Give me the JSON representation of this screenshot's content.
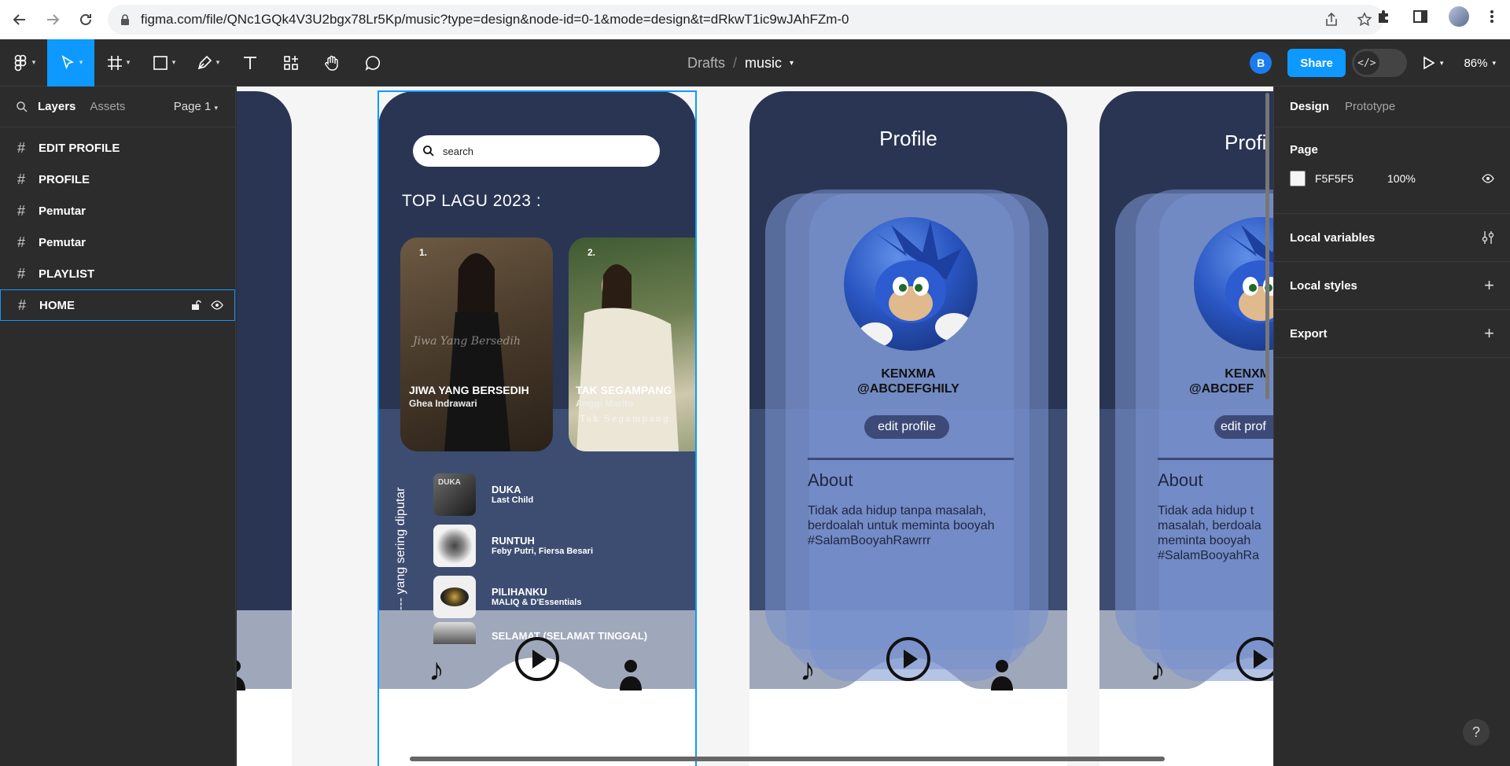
{
  "browser": {
    "url": "figma.com/file/QNc1GQk4V3U2bgx78Lr5Kp/music?type=design&node-id=0-1&mode=design&t=dRkwT1ic9wJAhFZm-0"
  },
  "toolbar": {
    "tools": [
      "figma-menu-icon",
      "move-tool-icon",
      "frame-tool-icon",
      "shape-tool-icon",
      "pen-tool-icon",
      "text-tool-icon",
      "resources-icon",
      "hand-tool-icon",
      "comment-tool-icon"
    ],
    "breadcrumb_parent": "Drafts",
    "breadcrumb_sep": "/",
    "file_name": "music",
    "user_initial": "B",
    "share_label": "Share",
    "dev_mode_glyph": "</>",
    "zoom": "86%"
  },
  "left_panel": {
    "tab_layers": "Layers",
    "tab_assets": "Assets",
    "page_selector": "Page 1",
    "layers": [
      {
        "name": "EDIT PROFILE",
        "selected": false
      },
      {
        "name": "PROFILE",
        "selected": false
      },
      {
        "name": "Pemutar",
        "selected": false
      },
      {
        "name": "Pemutar",
        "selected": false
      },
      {
        "name": "PLAYLIST",
        "selected": false
      },
      {
        "name": "HOME",
        "selected": true
      }
    ]
  },
  "right_panel": {
    "tab_design": "Design",
    "tab_prototype": "Prototype",
    "page_title": "Page",
    "page_color": "F5F5F5",
    "page_opacity": "100%",
    "local_variables": "Local variables",
    "local_styles": "Local styles",
    "export": "Export",
    "help": "?"
  },
  "home_frame": {
    "search_placeholder": "search",
    "top_heading": "TOP LAGU 2023 :",
    "top_songs": [
      {
        "rank": "1.",
        "title": "JIWA YANG BERSEDIH",
        "artist": "Ghea Indrawari",
        "script_text": "Jiwa Yang Bersedih"
      },
      {
        "rank": "2.",
        "title": "TAK SEGAMPANG",
        "artist": "Anggi Marito",
        "script_text": "Tak Segampang"
      }
    ],
    "side_label": "--- yang sering diputar",
    "list": [
      {
        "title": "DUKA",
        "artist": "Last Child",
        "cover_text": "DUKA"
      },
      {
        "title": "RUNTUH",
        "artist": "Feby Putri, Fiersa Besari",
        "cover_text": ""
      },
      {
        "title": "PILIHANKU",
        "artist": "MALIQ & D'Essentials",
        "cover_text": ""
      },
      {
        "title": "SELAMAT (SELAMAT TINGGAL)",
        "artist": "",
        "cover_text": ""
      }
    ]
  },
  "profile_frame": {
    "title": "Profile",
    "username": "KENXMA",
    "handle": "@ABCDEFGHILY",
    "edit_button": "edit profile",
    "about_heading": "About",
    "about_text": "Tidak ada hidup tanpa masalah, berdoalah untuk meminta booyah #SalamBooyahRawrrr"
  },
  "edit_profile_frame": {
    "title": "Profi",
    "username": "KENXM",
    "handle": "@ABCDEF",
    "edit_button": "edit prof",
    "about_heading": "About",
    "about_text": "Tidak ada hidup t masalah, berdoala meminta booyah #SalamBooyahRa"
  },
  "colors": {
    "figma_blue": "#0d99ff",
    "frame_dark": "#2a3554",
    "frame_mid": "#3d4d72",
    "card_blue": "#6d85c2"
  }
}
